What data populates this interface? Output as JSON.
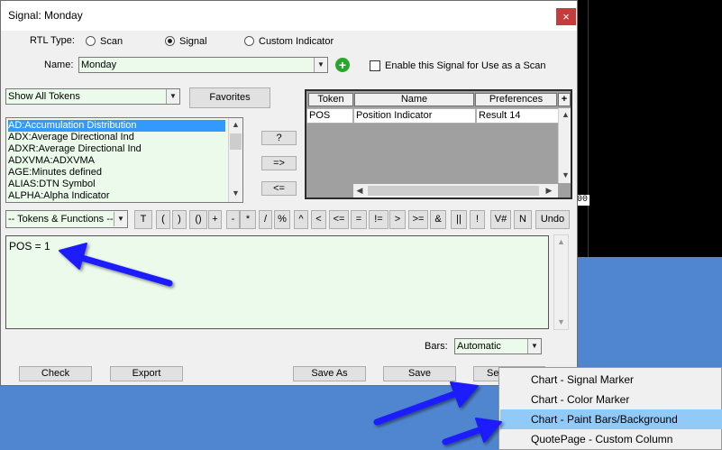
{
  "window": {
    "title": "Signal: Monday",
    "close_glyph": "×"
  },
  "rtl_type": {
    "label": "RTL Type:",
    "options": [
      "Scan",
      "Signal",
      "Custom Indicator"
    ],
    "selected": "Signal"
  },
  "name_field": {
    "label": "Name:",
    "value": "Monday"
  },
  "enable_scan": {
    "label": "Enable this Signal for Use as a Scan",
    "checked": false
  },
  "token_filter": {
    "value": "Show All Tokens"
  },
  "favorites_button": "Favorites",
  "tokens": [
    "AD:Accumulation Distribution",
    "ADX:Average Directional Ind",
    "ADXR:Average Directional Ind",
    "ADXVMA:ADXVMA",
    "AGE:Minutes defined",
    "ALIAS:DTN Symbol",
    "ALPHA:Alpha Indicator"
  ],
  "middle_buttons": [
    "?",
    "=>",
    "<="
  ],
  "grid": {
    "headers": [
      "Token",
      "Name",
      "Preferences"
    ],
    "add_glyph": "+",
    "rows": [
      [
        "POS",
        "Position Indicator",
        "Result 14"
      ]
    ]
  },
  "functions_combo": "-- Tokens & Functions --",
  "operators": [
    "T",
    "(",
    ")",
    "()",
    "+",
    "-",
    "*",
    "/",
    "%",
    "^",
    "<",
    "<=",
    "=",
    "!=",
    ">",
    ">=",
    "&",
    "||",
    "!",
    "V#",
    "N",
    "Undo"
  ],
  "editor_text": "POS = 1",
  "bars": {
    "label": "Bars:",
    "value": "Automatic"
  },
  "bottom_buttons": [
    "Check",
    "Export",
    "Save As",
    "Save",
    "Se"
  ],
  "context_menu": {
    "items": [
      "Chart - Signal Marker",
      "Chart - Color Marker",
      "Chart - Paint Bars/Background",
      "QuotePage - Custom Column"
    ],
    "highlighted_index": 2
  },
  "background_fragment": "00",
  "colors": {
    "accent_selection": "#3399ff",
    "field_bg": "#ebfaeb",
    "menu_highlight": "#91c9f7",
    "arrow": "#1a1aff",
    "close": "#c43c3c"
  }
}
